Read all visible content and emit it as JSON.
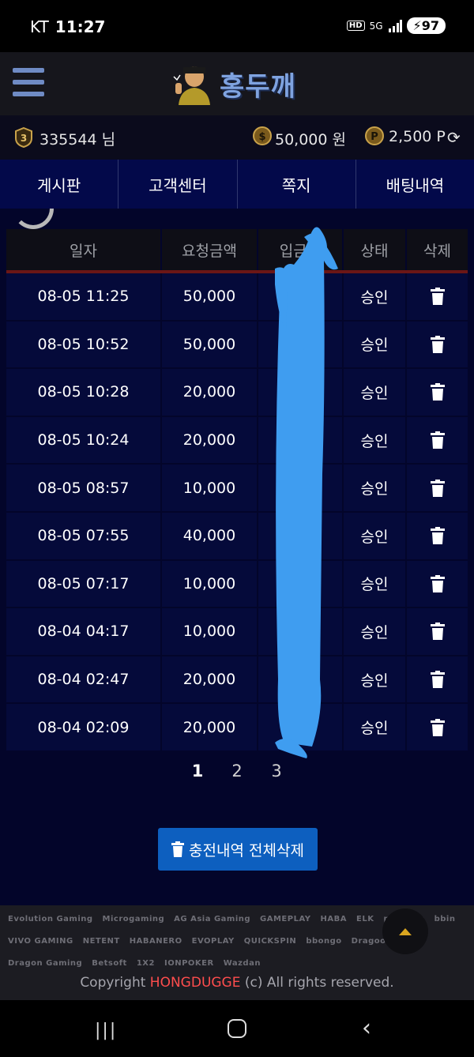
{
  "status_bar": {
    "carrier": "KT",
    "time": "11:27",
    "icons": [
      "hd-icon",
      "5g-icon",
      "signal-icon",
      "battery-icon"
    ],
    "hd_label": "HD",
    "network_label": "5G",
    "battery": "97"
  },
  "header": {
    "logo_text": "홍두깨",
    "accent_color": "#7fa3e0"
  },
  "user": {
    "username": "335544 님",
    "level": "3",
    "money": "50,000 원",
    "points": "2,500 P"
  },
  "nav": {
    "items": [
      {
        "label": "게시판"
      },
      {
        "label": "고객센터"
      },
      {
        "label": "쪽지"
      },
      {
        "label": "배팅내역"
      }
    ]
  },
  "table": {
    "headers": [
      "일자",
      "요청금액",
      "입금자",
      "상태",
      "삭제"
    ],
    "rows": [
      {
        "date": "08-05 11:25",
        "amount": "50,000",
        "status": "승인"
      },
      {
        "date": "08-05 10:52",
        "amount": "50,000",
        "status": "승인"
      },
      {
        "date": "08-05 10:28",
        "amount": "20,000",
        "status": "승인"
      },
      {
        "date": "08-05 10:24",
        "amount": "20,000",
        "status": "승인"
      },
      {
        "date": "08-05 08:57",
        "amount": "10,000",
        "status": "승인"
      },
      {
        "date": "08-05 07:55",
        "amount": "40,000",
        "status": "승인"
      },
      {
        "date": "08-05 07:17",
        "amount": "10,000",
        "status": "승인"
      },
      {
        "date": "08-04 04:17",
        "amount": "10,000",
        "status": "승인"
      },
      {
        "date": "08-04 02:47",
        "amount": "20,000",
        "status": "승인"
      },
      {
        "date": "08-04 02:09",
        "amount": "20,000",
        "status": "승인"
      }
    ]
  },
  "pagination": {
    "pages": [
      "1",
      "2",
      "3"
    ],
    "current": "1"
  },
  "actions": {
    "delete_all_label": "충전내역 전체삭제",
    "button_color": "#0d5fbf"
  },
  "footer": {
    "providers": [
      "Evolution Gaming",
      "Microgaming",
      "AG Asia Gaming",
      "GAMEPLAY",
      "HABA",
      "ELK",
      "playtech",
      "bbin",
      "VIVO GAMING",
      "NETENT",
      "HABANERO",
      "EVOPLAY",
      "QUICKSPIN",
      "bbongo",
      "Dragoon Soft",
      "Dragon Gaming",
      "Betsoft",
      "1X2",
      "IONPOKER",
      "Wazdan"
    ],
    "copyright_prefix": "Copyright ",
    "copyright_brand": "HONGDUGGE",
    "copyright_suffix": " (c) All rights reserved."
  },
  "colors": {
    "nav_bg": "#03094a",
    "content_bg": "#03052a",
    "scribble": "#3f9df0",
    "brand_red": "#ff4d4d"
  }
}
